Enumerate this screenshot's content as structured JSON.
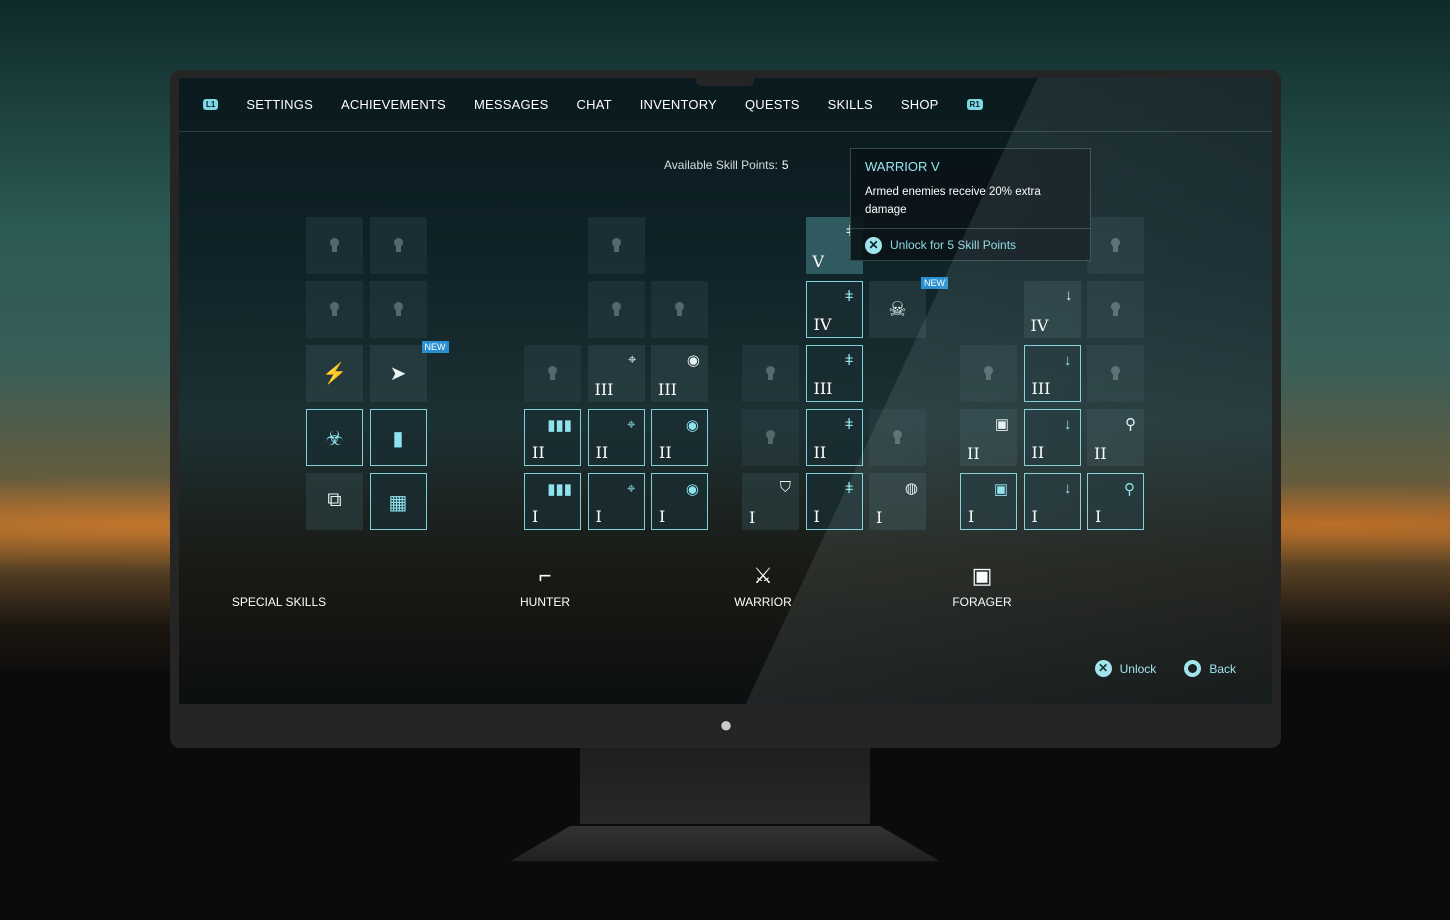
{
  "nav": {
    "left_bumper": "L1",
    "right_bumper": "R1",
    "items": [
      "SETTINGS",
      "ACHIEVEMENTS",
      "MESSAGES",
      "CHAT",
      "INVENTORY",
      "QUESTS",
      "SKILLS",
      "SHOP"
    ],
    "active": "SKILLS"
  },
  "skill_points": {
    "label": "Available Skill Points:",
    "value": "5"
  },
  "tooltip": {
    "title": "WARRIOR V",
    "description": "Armed enemies receive 20% extra damage",
    "action_button": "x-button-icon",
    "action": "Unlock for 5 Skill Points"
  },
  "groups": [
    {
      "name": "SPECIAL SKILLS",
      "icon": "",
      "columns": [
        [
          {
            "state": "locked"
          },
          {
            "state": "locked"
          },
          {
            "state": "dim",
            "icon": "battery-icon",
            "glyph": "⚡"
          },
          {
            "state": "active",
            "icon": "biohazard-icon",
            "glyph": "☣"
          },
          {
            "state": "dim",
            "icon": "binoculars-icon",
            "glyph": "⧉"
          }
        ],
        [
          {
            "state": "locked"
          },
          {
            "state": "locked"
          },
          {
            "state": "dim",
            "icon": "compass-icon",
            "glyph": "➤",
            "badge": "NEW"
          },
          {
            "state": "active",
            "icon": "walkie-talkie-icon",
            "glyph": "▮"
          },
          {
            "state": "active",
            "icon": "chip-icon",
            "glyph": "▦"
          }
        ]
      ]
    },
    {
      "name": "HUNTER",
      "icon": "pistol-icon",
      "glyph": "⌐",
      "columns": [
        [
          null,
          null,
          {
            "state": "locked"
          },
          {
            "state": "active",
            "icon": "bullets-icon",
            "glyph": "▮▮▮",
            "level": "II"
          },
          {
            "state": "active",
            "icon": "bullets-icon",
            "glyph": "▮▮▮",
            "level": "I"
          }
        ],
        [
          {
            "state": "locked"
          },
          {
            "state": "locked"
          },
          {
            "state": "dim",
            "icon": "crosshair-icon",
            "glyph": "⌖",
            "level": "III"
          },
          {
            "state": "active",
            "icon": "crosshair-icon",
            "glyph": "⌖",
            "level": "II"
          },
          {
            "state": "active",
            "icon": "crosshair-icon",
            "glyph": "⌖",
            "level": "I"
          }
        ],
        [
          null,
          {
            "state": "locked"
          },
          {
            "state": "dim",
            "icon": "eye-icon",
            "glyph": "◉",
            "level": "III"
          },
          {
            "state": "active",
            "icon": "eye-icon",
            "glyph": "◉",
            "level": "II"
          },
          {
            "state": "active",
            "icon": "eye-icon",
            "glyph": "◉",
            "level": "I"
          }
        ]
      ]
    },
    {
      "name": "WARRIOR",
      "icon": "crossed-swords-icon",
      "glyph": "⚔",
      "columns": [
        [
          null,
          null,
          {
            "state": "locked"
          },
          {
            "state": "locked"
          },
          {
            "state": "dim",
            "icon": "shield-icon",
            "glyph": "⛉",
            "level": "I"
          }
        ],
        [
          {
            "state": "selected",
            "icon": "sword-icon",
            "glyph": "ǂ",
            "level": "V"
          },
          {
            "state": "active",
            "icon": "sword-icon",
            "glyph": "ǂ",
            "level": "IV"
          },
          {
            "state": "active",
            "icon": "sword-icon",
            "glyph": "ǂ",
            "level": "III"
          },
          {
            "state": "active",
            "icon": "sword-icon",
            "glyph": "ǂ",
            "level": "II"
          },
          {
            "state": "active",
            "icon": "sword-icon",
            "glyph": "ǂ",
            "level": "I"
          }
        ],
        [
          null,
          {
            "state": "dim",
            "icon": "skull-icon",
            "glyph": "☠",
            "badge": "NEW"
          },
          null,
          {
            "state": "locked"
          },
          {
            "state": "dim",
            "icon": "grenade-icon",
            "glyph": "◍",
            "level": "I"
          }
        ]
      ]
    },
    {
      "name": "FORAGER",
      "icon": "backpack-icon",
      "glyph": "▣",
      "columns": [
        [
          null,
          null,
          {
            "state": "locked"
          },
          {
            "state": "dim",
            "icon": "backpack-icon",
            "glyph": "▣",
            "level": "II"
          },
          {
            "state": "active",
            "icon": "backpack-icon",
            "glyph": "▣",
            "level": "I"
          }
        ],
        [
          null,
          {
            "state": "dim",
            "icon": "shovel-icon",
            "glyph": "↓",
            "level": "IV"
          },
          {
            "state": "active",
            "icon": "shovel-icon",
            "glyph": "↓",
            "level": "III"
          },
          {
            "state": "active",
            "icon": "shovel-icon",
            "glyph": "↓",
            "level": "II"
          },
          {
            "state": "active",
            "icon": "shovel-icon",
            "glyph": "↓",
            "level": "I"
          }
        ],
        [
          {
            "state": "locked"
          },
          {
            "state": "locked"
          },
          {
            "state": "locked"
          },
          {
            "state": "dim",
            "icon": "search-icon",
            "glyph": "⚲",
            "level": "II"
          },
          {
            "state": "active",
            "icon": "search-icon",
            "glyph": "⚲",
            "level": "I"
          }
        ]
      ]
    }
  ],
  "footer": {
    "unlock": "Unlock",
    "back": "Back"
  },
  "colors": {
    "accent": "#7fd0d8",
    "badge": "#2a8fd0"
  },
  "device": {
    "logo": "apple-logo"
  }
}
